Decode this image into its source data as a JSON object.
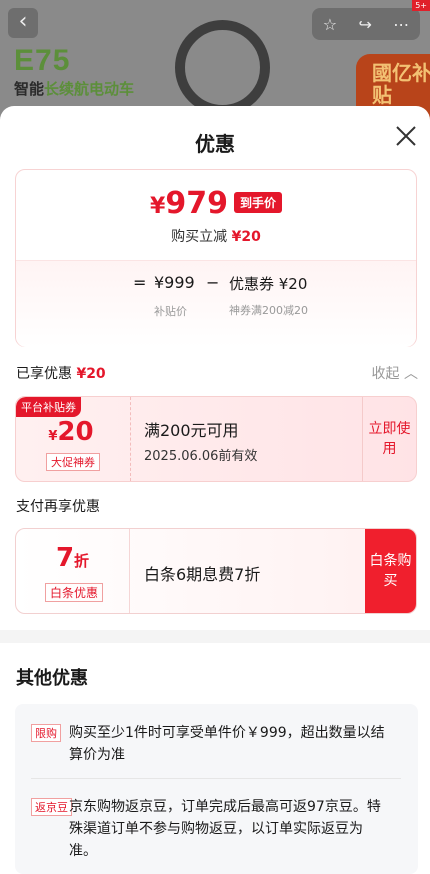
{
  "background": {
    "model_name": "E75",
    "slogan_prefix": "智能",
    "slogan_highlight": "长续航电动车",
    "subsidy_badge": "國亿补贴",
    "corner_badge": "5+"
  },
  "sheet": {
    "title": "优惠"
  },
  "price_card": {
    "currency": "¥",
    "final_price": "979",
    "final_tag": "到手价",
    "instant_label": "购买立减",
    "instant_amount": "¥20",
    "eq": "=",
    "base_price": "¥999",
    "minus": "−",
    "coupon_part": "优惠券 ¥20",
    "base_label": "补贴价",
    "coupon_label": "神券满200减20"
  },
  "enjoyed": {
    "label": "已享优惠",
    "amount": "¥20",
    "collapse_label": "收起"
  },
  "coupon": {
    "corner": "平台补贴券",
    "currency": "¥",
    "amount": "20",
    "type_label": "大促神券",
    "condition": "满200元可用",
    "validity": "2025.06.06前有效",
    "action": "立即使用"
  },
  "payment": {
    "section_title": "支付再享优惠",
    "discount": "7",
    "discount_unit": "折",
    "label": "白条优惠",
    "description": "白条6期息费7折",
    "action": "白条购买"
  },
  "other": {
    "title": "其他优惠",
    "items": [
      {
        "tag": "限购",
        "text": "购买至少1件时可享受单件价￥999，超出数量以结算价为准"
      },
      {
        "tag": "返京豆",
        "text": "京东购物返京豆，订单完成后最高可返97京豆。特殊渠道订单不参与购物返豆，以订单实际返豆为准。"
      }
    ]
  },
  "colors": {
    "accent": "#e4172b",
    "button": "#f01f2d"
  }
}
